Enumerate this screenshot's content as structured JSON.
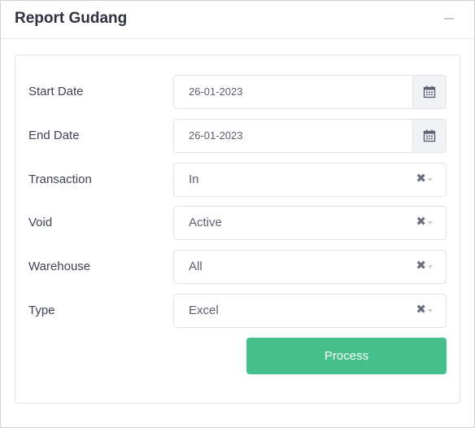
{
  "panel": {
    "title": "Report Gudang",
    "minimize_icon": "minus-icon"
  },
  "form": {
    "start_date": {
      "label": "Start Date",
      "value": "26-01-2023",
      "icon": "calendar-icon"
    },
    "end_date": {
      "label": "End Date",
      "value": "26-01-2023",
      "icon": "calendar-icon"
    },
    "transaction": {
      "label": "Transaction",
      "value": "In",
      "clear_symbol": "✖"
    },
    "void": {
      "label": "Void",
      "value": "Active",
      "clear_symbol": "✖"
    },
    "warehouse": {
      "label": "Warehouse",
      "value": "All",
      "clear_symbol": "✖"
    },
    "type": {
      "label": "Type",
      "value": "Excel",
      "clear_symbol": "✖"
    },
    "process_label": "Process"
  },
  "colors": {
    "accent": "#45c08c",
    "addon_bg": "#f1f2f6",
    "border": "#e2e4ea"
  }
}
